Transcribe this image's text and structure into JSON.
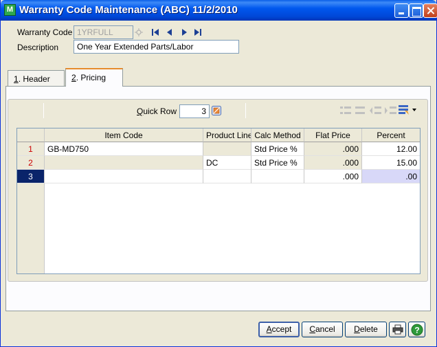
{
  "window": {
    "title": "Warranty Code Maintenance (ABC) 11/2/2010",
    "icon_text": "M"
  },
  "form": {
    "warranty_code_label": "Warranty Code",
    "warranty_code_value": "1YRFULL",
    "description_label": "Description",
    "description_value": "One Year Extended Parts/Labor"
  },
  "tabs": [
    {
      "mnemonic": "1",
      "label": ". Header"
    },
    {
      "mnemonic": "2",
      "label": ". Pricing"
    }
  ],
  "quick_row": {
    "label_mnemonic": "Q",
    "label_rest": "uick Row",
    "value": "3"
  },
  "grid": {
    "columns": [
      "Item Code",
      "Product Line",
      "Calc Method",
      "Flat Price",
      "Percent"
    ],
    "rows": [
      {
        "num": "1",
        "item_code": "GB-MD750",
        "product_line": "",
        "calc_method": "Std Price %",
        "flat_price": ".000",
        "percent": "12.00"
      },
      {
        "num": "2",
        "item_code": "",
        "product_line": "DC",
        "calc_method": "Std Price %",
        "flat_price": ".000",
        "percent": "15.00"
      },
      {
        "num": "3",
        "item_code": "",
        "product_line": "",
        "calc_method": "",
        "flat_price": ".000",
        "percent": ".00"
      }
    ]
  },
  "buttons": {
    "accept_mn": "A",
    "accept_rest": "ccept",
    "cancel_mn": "C",
    "cancel_rest": "ancel",
    "delete_mn": "D",
    "delete_rest": "elete"
  }
}
